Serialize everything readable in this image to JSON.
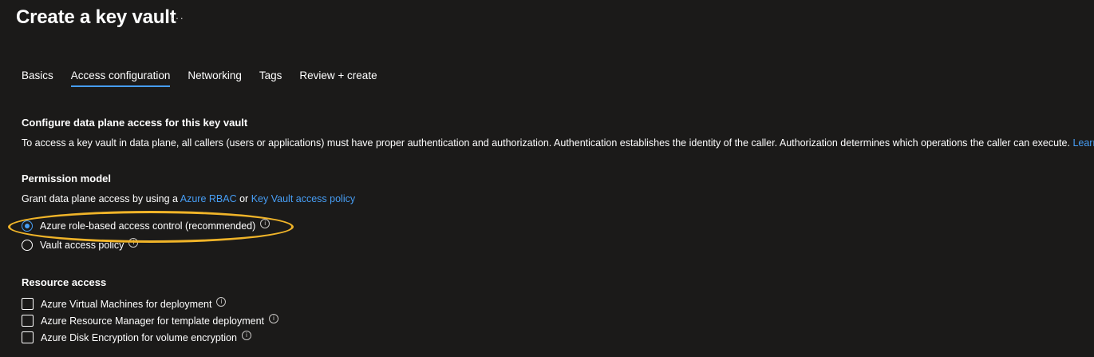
{
  "page": {
    "title": "Create a key vault",
    "more_label": "···"
  },
  "tabs": [
    {
      "label": "Basics"
    },
    {
      "label": "Access configuration"
    },
    {
      "label": "Networking"
    },
    {
      "label": "Tags"
    },
    {
      "label": "Review + create"
    }
  ],
  "active_tab": "Access configuration",
  "data_plane": {
    "heading": "Configure data plane access for this key vault",
    "description": "To access a key vault in data plane, all callers (users or applications) must have proper authentication and authorization. Authentication establishes the identity of the caller. Authorization determines which operations the caller can execute.",
    "learn_more": "Learn more"
  },
  "permission_model": {
    "heading": "Permission model",
    "desc_prefix": "Grant data plane access by using a",
    "link_rbac": "Azure RBAC",
    "or_text": "or",
    "link_policy": "Key Vault access policy",
    "options": [
      {
        "label": "Azure role-based access control (recommended)",
        "selected": true
      },
      {
        "label": "Vault access policy",
        "selected": false
      }
    ]
  },
  "resource_access": {
    "heading": "Resource access",
    "options": [
      {
        "label": "Azure Virtual Machines for deployment",
        "checked": false
      },
      {
        "label": "Azure Resource Manager for template deployment",
        "checked": false
      },
      {
        "label": "Azure Disk Encryption for volume encryption",
        "checked": false
      }
    ]
  },
  "info_glyph": "i",
  "colors": {
    "background": "#1b1a19",
    "accent": "#479ef5",
    "highlight": "#f0b429"
  }
}
